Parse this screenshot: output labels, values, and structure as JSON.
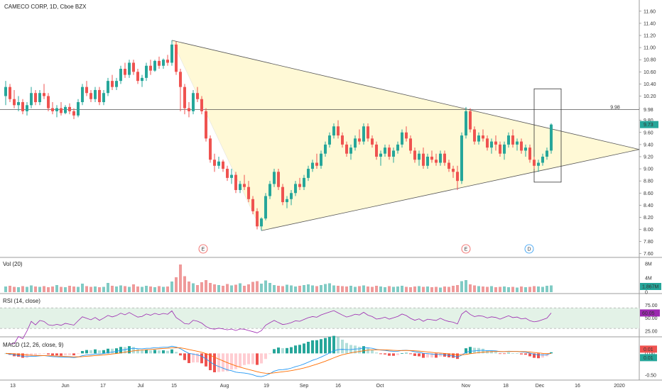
{
  "colors": {
    "up": "#26a69a",
    "down": "#ef5350",
    "triangle_fill": "#fff9d6",
    "rsi_band": "#e3f2e7",
    "rsi_line": "#9c27b0",
    "macd_line": "#2196f3",
    "signal_line": "#ff6d00",
    "last_price_badge": "#26a69a"
  },
  "chart_data": [
    {
      "type": "candlestick",
      "title": "CAMECO CORP, 1D, Cboe BZX",
      "ylim": [
        7.55,
        11.75
      ],
      "yticks": [
        "11.60",
        "11.40",
        "11.20",
        "11.00",
        "10.80",
        "10.60",
        "10.40",
        "10.20",
        "10.00",
        "9.80",
        "9.60",
        "9.40",
        "9.20",
        "9.00",
        "8.80",
        "8.60",
        "8.40",
        "8.20",
        "8.00",
        "7.80",
        "7.60"
      ],
      "xticks": [
        "13",
        "Jun",
        "17",
        "Jul",
        "15",
        "Aug",
        "19",
        "Sep",
        "16",
        "Oct",
        "Nov",
        "18",
        "Dec",
        "16",
        "2020"
      ],
      "horizontal_line": {
        "value": 9.98,
        "label": "9.98"
      },
      "last_price": {
        "value": 9.73,
        "label": "9.73"
      },
      "events": [
        "E",
        "E",
        "D"
      ],
      "candles_ohlc": [
        [
          10.2,
          10.45,
          10.05,
          10.35
        ],
        [
          10.35,
          10.4,
          10.1,
          10.15
        ],
        [
          10.15,
          10.3,
          10.0,
          10.05
        ],
        [
          10.05,
          10.2,
          9.95,
          10.1
        ],
        [
          10.1,
          10.15,
          9.9,
          9.95
        ],
        [
          9.95,
          10.1,
          9.88,
          10.05
        ],
        [
          10.05,
          10.35,
          10.0,
          10.25
        ],
        [
          10.25,
          10.3,
          10.05,
          10.1
        ],
        [
          10.1,
          10.3,
          10.05,
          10.25
        ],
        [
          10.25,
          10.4,
          10.15,
          10.2
        ],
        [
          10.2,
          10.25,
          9.95,
          10.0
        ],
        [
          10.0,
          10.1,
          9.9,
          9.95
        ],
        [
          9.95,
          10.05,
          9.85,
          10.0
        ],
        [
          10.0,
          10.1,
          9.88,
          9.92
        ],
        [
          9.92,
          10.05,
          9.9,
          10.02
        ],
        [
          10.02,
          10.08,
          9.9,
          9.95
        ],
        [
          9.95,
          10.0,
          9.82,
          9.88
        ],
        [
          9.88,
          10.15,
          9.85,
          10.1
        ],
        [
          10.1,
          10.4,
          10.05,
          10.35
        ],
        [
          10.35,
          10.45,
          10.2,
          10.25
        ],
        [
          10.25,
          10.3,
          10.1,
          10.15
        ],
        [
          10.15,
          10.35,
          10.1,
          10.3
        ],
        [
          10.3,
          10.35,
          10.05,
          10.1
        ],
        [
          10.1,
          10.3,
          10.05,
          10.25
        ],
        [
          10.25,
          10.5,
          10.2,
          10.45
        ],
        [
          10.45,
          10.55,
          10.3,
          10.35
        ],
        [
          10.35,
          10.5,
          10.3,
          10.45
        ],
        [
          10.45,
          10.7,
          10.4,
          10.65
        ],
        [
          10.65,
          10.75,
          10.5,
          10.55
        ],
        [
          10.55,
          10.8,
          10.5,
          10.75
        ],
        [
          10.75,
          10.8,
          10.55,
          10.6
        ],
        [
          10.6,
          10.65,
          10.4,
          10.45
        ],
        [
          10.45,
          10.55,
          10.35,
          10.5
        ],
        [
          10.5,
          10.75,
          10.45,
          10.7
        ],
        [
          10.7,
          10.8,
          10.55,
          10.62
        ],
        [
          10.62,
          10.8,
          10.6,
          10.78
        ],
        [
          10.78,
          10.85,
          10.65,
          10.7
        ],
        [
          10.7,
          10.82,
          10.65,
          10.8
        ],
        [
          10.8,
          10.88,
          10.7,
          10.75
        ],
        [
          10.75,
          11.12,
          10.7,
          11.05
        ],
        [
          11.05,
          11.1,
          10.55,
          10.6
        ],
        [
          10.6,
          10.65,
          9.95,
          10.35
        ],
        [
          10.35,
          10.4,
          9.9,
          10.0
        ],
        [
          10.0,
          10.1,
          9.85,
          9.95
        ],
        [
          9.95,
          10.3,
          9.9,
          10.25
        ],
        [
          10.25,
          10.35,
          10.1,
          10.15
        ],
        [
          10.15,
          10.2,
          9.9,
          9.95
        ],
        [
          9.95,
          10.0,
          9.45,
          9.5
        ],
        [
          9.5,
          9.55,
          9.1,
          9.15
        ],
        [
          9.15,
          9.25,
          8.95,
          9.05
        ],
        [
          9.05,
          9.2,
          9.0,
          9.12
        ],
        [
          9.12,
          9.15,
          8.95,
          9.0
        ],
        [
          9.0,
          9.05,
          8.8,
          8.85
        ],
        [
          8.85,
          9.0,
          8.75,
          8.9
        ],
        [
          8.9,
          8.95,
          8.6,
          8.65
        ],
        [
          8.65,
          8.8,
          8.6,
          8.75
        ],
        [
          8.75,
          8.9,
          8.65,
          8.7
        ],
        [
          8.7,
          8.8,
          8.45,
          8.5
        ],
        [
          8.5,
          8.55,
          8.25,
          8.3
        ],
        [
          8.3,
          8.35,
          8.0,
          8.05
        ],
        [
          8.05,
          8.2,
          7.98,
          8.18
        ],
        [
          8.18,
          8.6,
          8.15,
          8.55
        ],
        [
          8.55,
          8.8,
          8.5,
          8.75
        ],
        [
          8.75,
          9.0,
          8.7,
          8.95
        ],
        [
          8.95,
          9.0,
          8.65,
          8.7
        ],
        [
          8.7,
          8.75,
          8.4,
          8.45
        ],
        [
          8.45,
          8.55,
          8.35,
          8.5
        ],
        [
          8.5,
          8.65,
          8.4,
          8.6
        ],
        [
          8.6,
          8.8,
          8.55,
          8.75
        ],
        [
          8.75,
          8.85,
          8.65,
          8.7
        ],
        [
          8.7,
          8.9,
          8.65,
          8.85
        ],
        [
          8.85,
          9.05,
          8.8,
          9.0
        ],
        [
          9.0,
          9.15,
          8.95,
          9.1
        ],
        [
          9.1,
          9.25,
          9.0,
          9.05
        ],
        [
          9.05,
          9.3,
          9.0,
          9.25
        ],
        [
          9.25,
          9.45,
          9.2,
          9.4
        ],
        [
          9.4,
          9.6,
          9.35,
          9.55
        ],
        [
          9.55,
          9.75,
          9.5,
          9.7
        ],
        [
          9.7,
          9.8,
          9.5,
          9.55
        ],
        [
          9.55,
          9.6,
          9.35,
          9.4
        ],
        [
          9.4,
          9.45,
          9.2,
          9.25
        ],
        [
          9.25,
          9.4,
          9.15,
          9.35
        ],
        [
          9.35,
          9.55,
          9.3,
          9.5
        ],
        [
          9.5,
          9.65,
          9.4,
          9.45
        ],
        [
          9.45,
          9.75,
          9.4,
          9.7
        ],
        [
          9.7,
          9.75,
          9.45,
          9.5
        ],
        [
          9.5,
          9.55,
          9.35,
          9.4
        ],
        [
          9.4,
          9.45,
          9.15,
          9.2
        ],
        [
          9.2,
          9.3,
          9.05,
          9.25
        ],
        [
          9.25,
          9.4,
          9.2,
          9.35
        ],
        [
          9.35,
          9.4,
          9.15,
          9.2
        ],
        [
          9.2,
          9.35,
          9.1,
          9.3
        ],
        [
          9.3,
          9.45,
          9.25,
          9.4
        ],
        [
          9.4,
          9.65,
          9.35,
          9.6
        ],
        [
          9.6,
          9.7,
          9.45,
          9.5
        ],
        [
          9.5,
          9.55,
          9.25,
          9.3
        ],
        [
          9.3,
          9.35,
          9.1,
          9.15
        ],
        [
          9.15,
          9.3,
          9.05,
          9.25
        ],
        [
          9.25,
          9.35,
          9.0,
          9.05
        ],
        [
          9.05,
          9.25,
          9.0,
          9.2
        ],
        [
          9.2,
          9.3,
          9.1,
          9.15
        ],
        [
          9.15,
          9.25,
          9.05,
          9.1
        ],
        [
          9.1,
          9.3,
          9.05,
          9.25
        ],
        [
          9.25,
          9.3,
          9.05,
          9.1
        ],
        [
          9.1,
          9.15,
          8.95,
          9.0
        ],
        [
          9.0,
          9.05,
          8.85,
          8.95
        ],
        [
          8.95,
          9.05,
          8.65,
          8.8
        ],
        [
          8.8,
          9.6,
          8.75,
          9.55
        ],
        [
          9.55,
          10.02,
          9.5,
          9.95
        ],
        [
          9.95,
          10.0,
          9.6,
          9.65
        ],
        [
          9.65,
          9.7,
          9.4,
          9.45
        ],
        [
          9.45,
          9.6,
          9.4,
          9.55
        ],
        [
          9.55,
          9.65,
          9.45,
          9.5
        ],
        [
          9.5,
          9.55,
          9.3,
          9.35
        ],
        [
          9.35,
          9.5,
          9.25,
          9.45
        ],
        [
          9.45,
          9.55,
          9.3,
          9.4
        ],
        [
          9.4,
          9.45,
          9.2,
          9.25
        ],
        [
          9.25,
          9.45,
          9.15,
          9.4
        ],
        [
          9.4,
          9.6,
          9.35,
          9.55
        ],
        [
          9.55,
          9.65,
          9.35,
          9.4
        ],
        [
          9.4,
          9.5,
          9.3,
          9.45
        ],
        [
          9.45,
          9.5,
          9.25,
          9.3
        ],
        [
          9.3,
          9.4,
          9.2,
          9.35
        ],
        [
          9.35,
          9.4,
          9.1,
          9.15
        ],
        [
          9.15,
          9.2,
          9.0,
          9.05
        ],
        [
          9.05,
          9.15,
          8.95,
          9.1
        ],
        [
          9.1,
          9.25,
          9.05,
          9.2
        ],
        [
          9.2,
          9.35,
          9.15,
          9.3
        ],
        [
          9.3,
          9.75,
          9.25,
          9.73
        ]
      ]
    },
    {
      "type": "bar",
      "title": "Vol (20)",
      "yticks": [
        "8M",
        "4M",
        "0"
      ],
      "last_value_label": "1.867M",
      "values": [
        1.6,
        1.8,
        1.5,
        1.4,
        1.7,
        1.5,
        1.9,
        1.6,
        1.5,
        1.7,
        1.4,
        1.6,
        2.0,
        1.5,
        1.4,
        1.8,
        1.6,
        1.5,
        2.4,
        1.7,
        1.5,
        1.6,
        1.4,
        1.5,
        2.6,
        1.8,
        1.6,
        1.9,
        1.7,
        1.5,
        2.2,
        1.6,
        1.5,
        1.8,
        1.6,
        1.4,
        1.7,
        1.5,
        1.6,
        3.0,
        4.2,
        7.8,
        4.5,
        3.0,
        2.5,
        2.0,
        2.8,
        3.4,
        2.6,
        2.2,
        2.0,
        1.8,
        2.3,
        1.9,
        2.1,
        2.5,
        1.8,
        2.2,
        2.9,
        3.1,
        2.4,
        3.3,
        2.6,
        2.0,
        1.8,
        1.7,
        2.1,
        1.9,
        1.6,
        1.8,
        2.0,
        2.2,
        1.9,
        1.7,
        2.0,
        2.3,
        2.5,
        1.9,
        1.8,
        1.7,
        1.6,
        1.8,
        1.5,
        1.7,
        1.9,
        1.6,
        1.5,
        1.8,
        1.6,
        1.4,
        1.7,
        1.5,
        1.6,
        1.8,
        1.5,
        1.4,
        1.6,
        1.7,
        1.5,
        1.6,
        1.4,
        1.5,
        1.3,
        1.6,
        1.5,
        1.8,
        2.0,
        3.1,
        3.4,
        2.2,
        1.9,
        1.7,
        1.6,
        1.5,
        1.7,
        1.4,
        1.5,
        1.6,
        1.4,
        1.5,
        1.3,
        1.6,
        1.4,
        1.5,
        1.7,
        1.6,
        1.5,
        1.8,
        1.9,
        2.0
      ]
    },
    {
      "type": "line",
      "title": "RSI (14, close)",
      "yticks": [
        "75.00",
        "50.00",
        "25.00"
      ],
      "ylim": [
        15,
        95
      ],
      "band": [
        30,
        70
      ],
      "last_value_label": "60.05"
    },
    {
      "type": "bar+line",
      "title": "MACD (12, 26, close, 9)",
      "yticks": [
        "0.00",
        "-0.50"
      ],
      "last_value_labels": [
        "0.01",
        "0.01"
      ]
    }
  ]
}
